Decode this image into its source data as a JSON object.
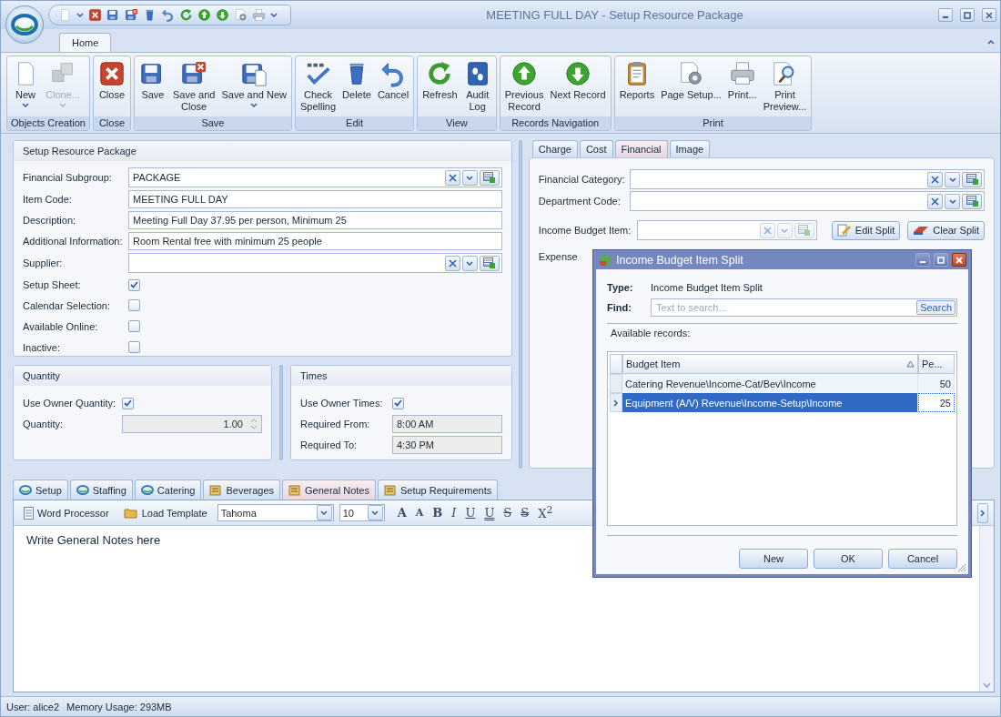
{
  "window": {
    "title": "MEETING FULL DAY - Setup Resource Package"
  },
  "ribbon": {
    "tabs": [
      {
        "label": "Home",
        "selected": true
      }
    ],
    "groups": [
      {
        "label": "Objects Creation",
        "buttons": [
          {
            "label": "New",
            "kind": "new",
            "dropdown": true,
            "disabled": false
          },
          {
            "label": "Clone...",
            "kind": "clone",
            "dropdown": true,
            "disabled": true
          }
        ]
      },
      {
        "label": "Close",
        "buttons": [
          {
            "label": "Close",
            "kind": "close",
            "dropdown": false,
            "disabled": false
          }
        ]
      },
      {
        "label": "Save",
        "buttons": [
          {
            "label": "Save",
            "kind": "save",
            "dropdown": false,
            "disabled": false
          },
          {
            "label": "Save and\nClose",
            "kind": "saveclose",
            "dropdown": false,
            "disabled": false
          },
          {
            "label": "Save and New",
            "kind": "savenew",
            "dropdown": true,
            "disabled": false
          }
        ]
      },
      {
        "label": "Edit",
        "buttons": [
          {
            "label": "Check\nSpelling",
            "kind": "spell",
            "dropdown": false,
            "disabled": false
          },
          {
            "label": "Delete",
            "kind": "delete",
            "dropdown": false,
            "disabled": false
          },
          {
            "label": "Cancel",
            "kind": "cancel",
            "dropdown": false,
            "disabled": false
          }
        ]
      },
      {
        "label": "View",
        "buttons": [
          {
            "label": "Refresh",
            "kind": "refresh",
            "dropdown": false,
            "disabled": false
          },
          {
            "label": "Audit\nLog",
            "kind": "audit",
            "dropdown": false,
            "disabled": false
          }
        ]
      },
      {
        "label": "Records Navigation",
        "buttons": [
          {
            "label": "Previous\nRecord",
            "kind": "prev",
            "dropdown": false,
            "disabled": false
          },
          {
            "label": "Next Record",
            "kind": "next",
            "dropdown": false,
            "disabled": false
          }
        ]
      },
      {
        "label": "Print",
        "buttons": [
          {
            "label": "Reports",
            "kind": "reports",
            "dropdown": false,
            "disabled": false
          },
          {
            "label": "Page Setup...",
            "kind": "pagesetup",
            "dropdown": false,
            "disabled": false
          },
          {
            "label": "Print...",
            "kind": "print",
            "dropdown": false,
            "disabled": false
          },
          {
            "label": "Print\nPreview...",
            "kind": "preview",
            "dropdown": false,
            "disabled": false
          }
        ]
      }
    ]
  },
  "setup": {
    "title": "Setup Resource Package",
    "fields": [
      {
        "kind": "lookup",
        "label": "Financial Subgroup:",
        "value": "PACKAGE"
      },
      {
        "kind": "text",
        "label": "Item Code:",
        "value": "MEETING FULL DAY"
      },
      {
        "kind": "text",
        "label": "Description:",
        "value": "Meeting Full Day 37.95 per person, Minimum 25"
      },
      {
        "kind": "text",
        "label": "Additional Information:",
        "value": "Room Rental free with minimum 25 people"
      },
      {
        "kind": "lookup",
        "label": "Supplier:"
      },
      {
        "kind": "checkbox",
        "label": "Setup Sheet:",
        "checked": true
      },
      {
        "kind": "checkbox",
        "label": "Calendar Selection:",
        "checked": false
      },
      {
        "kind": "checkbox",
        "label": "Available Online:",
        "checked": false
      },
      {
        "kind": "checkbox",
        "label": "Inactive:",
        "checked": false
      }
    ]
  },
  "quantity": {
    "title": "Quantity",
    "use_owner": {
      "label": "Use Owner Quantity:",
      "checked": true
    },
    "field": {
      "label": "Quantity:",
      "value": "1.00",
      "disabled": true
    }
  },
  "times": {
    "title": "Times",
    "use_owner": {
      "label": "Use Owner Times:",
      "checked": true
    },
    "fields": [
      {
        "label": "Required From:",
        "value": "8:00 AM",
        "disabled": true
      },
      {
        "label": "Required To:",
        "value": "4:30 PM",
        "disabled": true
      }
    ]
  },
  "detail_tabs": [
    {
      "label": "Charge",
      "selected": false
    },
    {
      "label": "Cost",
      "selected": false
    },
    {
      "label": "Financial",
      "selected": true
    },
    {
      "label": "Image",
      "selected": false
    }
  ],
  "financial": {
    "fields": [
      {
        "label": "Financial Category:",
        "disabled": false
      },
      {
        "label": "Department Code:",
        "disabled": false
      }
    ],
    "income": {
      "label": "Income Budget Item:",
      "disabled": true,
      "buttons": [
        "Edit Split",
        "Clear Split"
      ]
    },
    "expense_label": "Expense"
  },
  "bottom_tabs": [
    {
      "label": "Setup",
      "selected": false
    },
    {
      "label": "Staffing",
      "selected": false
    },
    {
      "label": "Catering",
      "selected": false
    },
    {
      "label": "Beverages",
      "selected": false
    },
    {
      "label": "General Notes",
      "selected": true
    },
    {
      "label": "Setup Requirements",
      "selected": false
    }
  ],
  "editor": {
    "buttons": [
      "Word Processor",
      "Load Template"
    ],
    "font": "Tahoma",
    "size": "10",
    "format": [
      {
        "kind": "grow",
        "label": "A"
      },
      {
        "kind": "shrink",
        "label": "A"
      },
      {
        "kind": "bold",
        "label": "B"
      },
      {
        "kind": "italic",
        "label": "I"
      },
      {
        "kind": "underline",
        "label": "U"
      },
      {
        "kind": "dunderline",
        "label": "U"
      },
      {
        "kind": "strike",
        "label": "S"
      },
      {
        "kind": "dstrike",
        "label": "S"
      },
      {
        "kind": "super",
        "label": "X$^{2}$"
      }
    ],
    "placeholder": "Write General Notes here"
  },
  "status_bar": {
    "user": "User: alice2",
    "memory": "Memory Usage: 293MB"
  },
  "dialog": {
    "title": "Income Budget Item Split",
    "type_label": "Type:",
    "type_value": "Income Budget Item Split",
    "find_label": "Find:",
    "find_placeholder": "Text to search...",
    "search_button": "Search",
    "records_label": "Available records:",
    "columns": [
      {
        "label": "Budget Item",
        "sorted": true
      },
      {
        "label": "Pe...",
        "sorted": false
      }
    ],
    "rows": [
      {
        "cells": [
          "Catering Revenue\\Income-Cat/Bev\\Income",
          "50"
        ],
        "selected": false
      },
      {
        "cells": [
          "Equipment (A/V) Revenue\\Income-Setup\\Income",
          "25"
        ],
        "selected": true
      }
    ],
    "buttons": [
      "New",
      "OK",
      "Cancel"
    ]
  }
}
